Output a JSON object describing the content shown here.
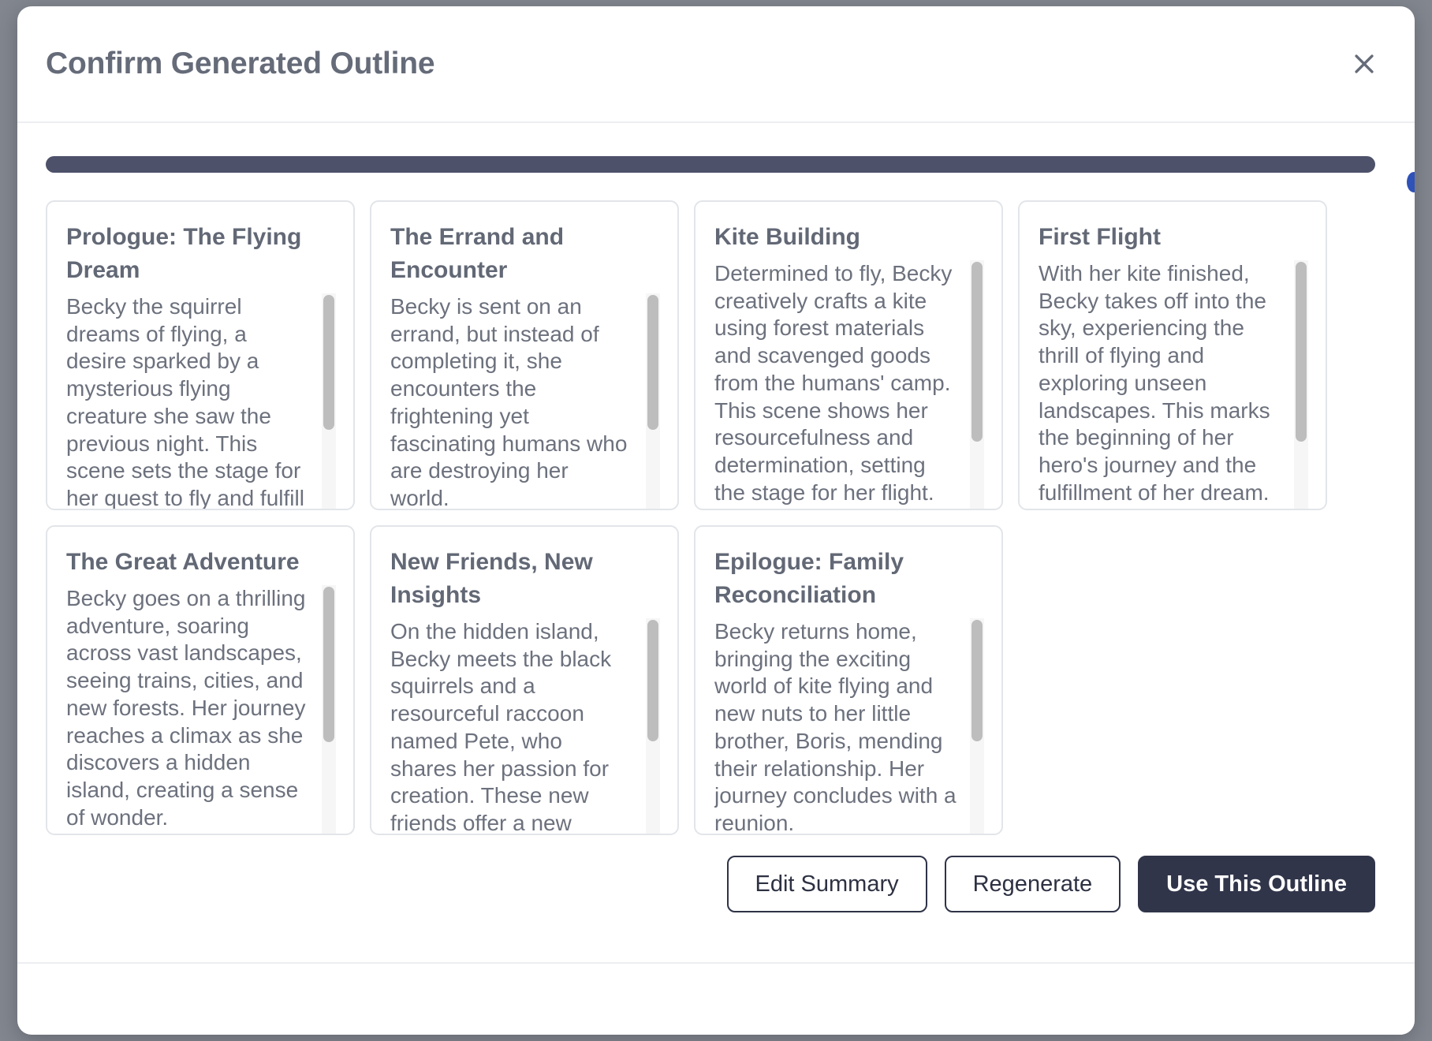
{
  "modal": {
    "title": "Confirm Generated Outline",
    "close_icon": "close-icon"
  },
  "progress": {
    "value_percent": 100,
    "color": "#4d5169"
  },
  "cards": [
    {
      "title": "Prologue: The Flying Dream",
      "text": "Becky the squirrel dreams of flying, a desire sparked by a mysterious flying creature she saw the previous night. This scene sets the stage for her quest to fly and fulfill her dream.",
      "scroll_thumb_percent": 62
    },
    {
      "title": "The Errand and Encounter",
      "text": "Becky is sent on an errand, but instead of completing it, she encounters the frightening yet fascinating humans who are destroying her world.",
      "scroll_thumb_percent": 62
    },
    {
      "title": "Kite Building",
      "text": "Determined to fly, Becky creatively crafts a kite using forest materials and scavenged goods from the humans' camp. This scene shows her resourcefulness and determination, setting the stage for her flight.",
      "scroll_thumb_percent": 72
    },
    {
      "title": "First Flight",
      "text": "With her kite finished, Becky takes off into the sky, experiencing the thrill of flying and exploring unseen landscapes. This marks the beginning of her hero's journey and the fulfillment of her dream.",
      "scroll_thumb_percent": 72
    },
    {
      "title": "The Great Adventure",
      "text": "Becky goes on a thrilling adventure, soaring across vast landscapes, seeing trains, cities, and new forests. Her journey reaches a climax as she discovers a hidden island, creating a sense of wonder.",
      "scroll_thumb_percent": 62
    },
    {
      "title": "New Friends, New Insights",
      "text": "On the hidden island, Becky meets the black squirrels and a resourceful raccoon named Pete, who shares her passion for creation. These new friends offer a new perspective.",
      "scroll_thumb_percent": 56
    },
    {
      "title": "Epilogue: Family Reconciliation",
      "text": "Becky returns home, bringing the exciting world of kite flying and new nuts to her little brother, Boris, mending their relationship. Her journey concludes with a reunion.",
      "scroll_thumb_percent": 56
    }
  ],
  "actions": {
    "edit_summary": "Edit Summary",
    "regenerate": "Regenerate",
    "use_outline": "Use This Outline"
  }
}
